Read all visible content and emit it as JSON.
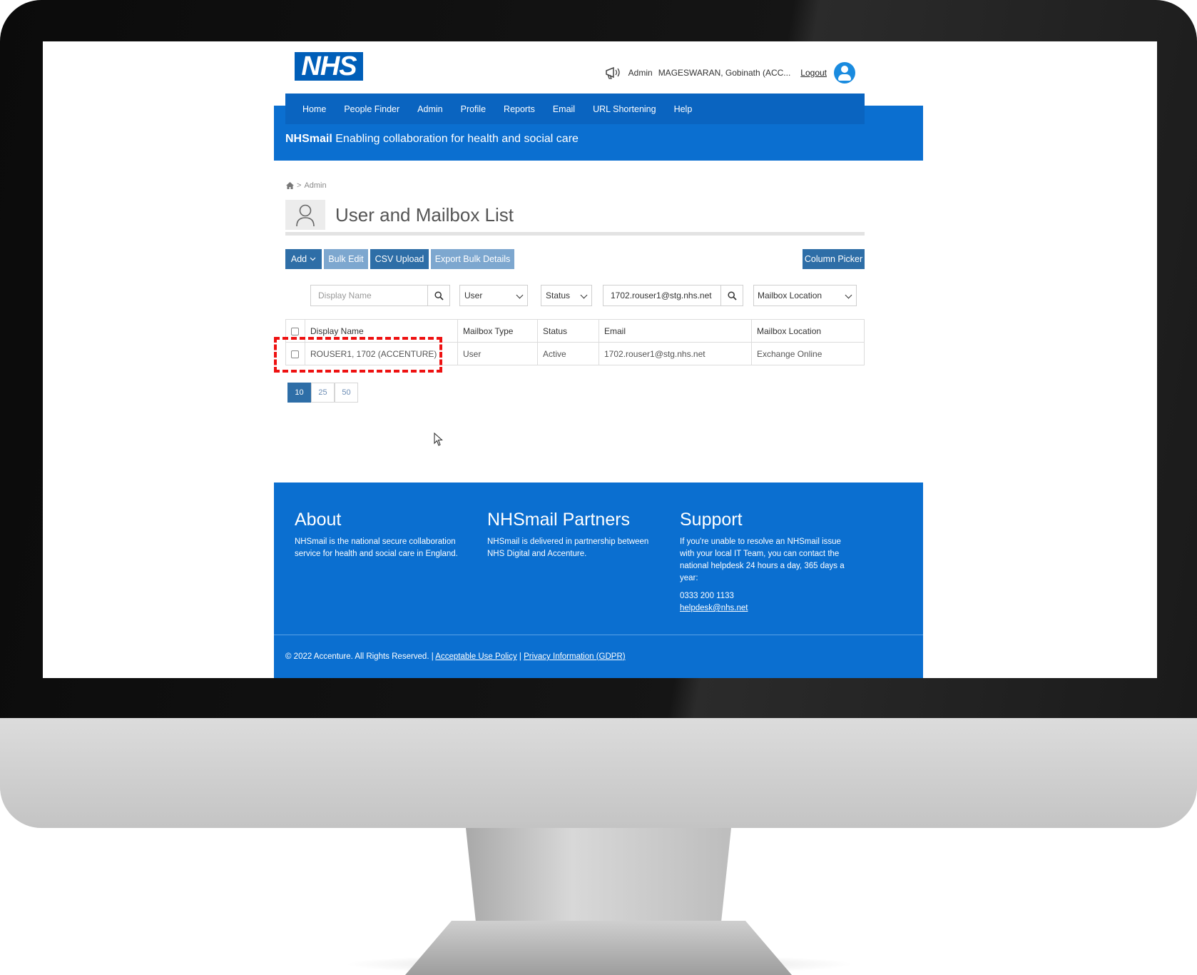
{
  "header": {
    "logo_text": "NHS",
    "role_label": "Admin",
    "user_name": "MAGESWARAN, Gobinath (ACC...",
    "logout_label": "Logout"
  },
  "nav": {
    "items": [
      "Home",
      "People Finder",
      "Admin",
      "Profile",
      "Reports",
      "Email",
      "URL Shortening",
      "Help"
    ]
  },
  "banner": {
    "brand": "NHSmail",
    "tagline": "Enabling collaboration for health and social care"
  },
  "breadcrumb": {
    "separator": ">",
    "current": "Admin"
  },
  "page": {
    "title": "User and Mailbox List"
  },
  "toolbar": {
    "add_label": "Add",
    "bulk_edit_label": "Bulk Edit",
    "csv_upload_label": "CSV Upload",
    "export_label": "Export Bulk Details",
    "column_picker_label": "Column Picker"
  },
  "filters": {
    "display_name_placeholder": "Display Name",
    "type_value": "User",
    "status_value": "Status",
    "email_value": "1702.rouser1@stg.nhs.net",
    "location_value": "Mailbox Location"
  },
  "table": {
    "headers": [
      "Display Name",
      "Mailbox Type",
      "Status",
      "Email",
      "Mailbox Location"
    ],
    "rows": [
      [
        "ROUSER1, 1702 (ACCENTURE)",
        "User",
        "Active",
        "1702.rouser1@stg.nhs.net",
        "Exchange Online"
      ]
    ]
  },
  "pagination": {
    "sizes": [
      "10",
      "25",
      "50"
    ],
    "active": "10"
  },
  "footer": {
    "about_title": "About",
    "about_text": "NHSmail is the national secure collaboration service for health and social care in England.",
    "partners_title": "NHSmail Partners",
    "partners_text": "NHSmail is delivered in partnership between NHS Digital and Accenture.",
    "support_title": "Support",
    "support_text": "If you're unable to resolve an NHSmail issue with your local IT Team, you can contact the national helpdesk 24 hours a day, 365 days a year:",
    "support_phone": "0333 200 1133",
    "support_email": "helpdesk@nhs.net",
    "copyright": "© 2022 Accenture. All Rights Reserved. |",
    "aup_link": "Acceptable Use Policy",
    "link_separator": "|",
    "privacy_link": "Privacy Information (GDPR)"
  },
  "colors": {
    "nhs_blue": "#005eb8",
    "banner_blue": "#0b6fd0",
    "button_blue": "#2e6ea7",
    "button_disabled": "#7da7cf",
    "highlight_red": "#ee1111"
  },
  "icons": [
    "megaphone-icon",
    "account-icon",
    "home-icon",
    "person-icon",
    "search-icon",
    "chevron-down-icon",
    "checkbox-icon",
    "mouse-cursor-icon"
  ]
}
